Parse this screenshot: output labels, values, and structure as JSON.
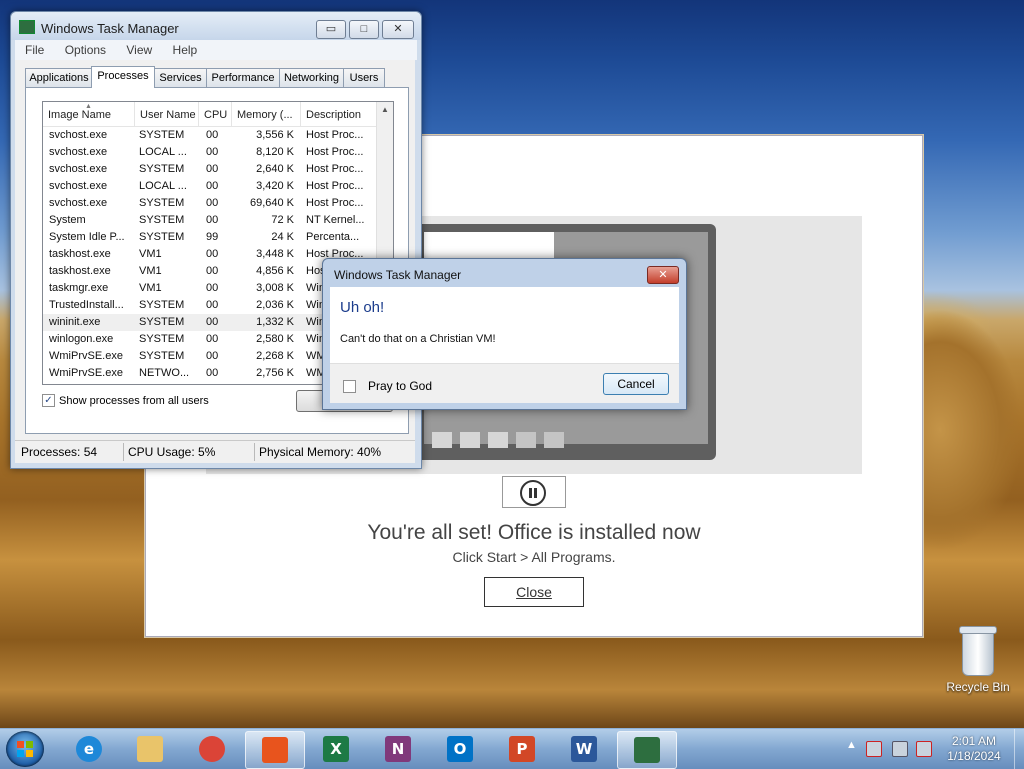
{
  "desktop": {
    "recycle_bin_label": "Recycle Bin"
  },
  "office": {
    "headline": "You're all set! Office is installed now",
    "sub": "Click Start > All Programs.",
    "close_label": "Close"
  },
  "task_manager": {
    "title": "Windows Task Manager",
    "menu": [
      "File",
      "Options",
      "View",
      "Help"
    ],
    "tabs": [
      "Applications",
      "Processes",
      "Services",
      "Performance",
      "Networking",
      "Users"
    ],
    "active_tab": "Processes",
    "columns": [
      "Image Name",
      "User Name",
      "CPU",
      "Memory (...",
      "Description"
    ],
    "rows": [
      {
        "name": "svchost.exe",
        "user": "SYSTEM",
        "cpu": "00",
        "mem": "3,556 K",
        "desc": "Host Proc..."
      },
      {
        "name": "svchost.exe",
        "user": "LOCAL ...",
        "cpu": "00",
        "mem": "8,120 K",
        "desc": "Host Proc..."
      },
      {
        "name": "svchost.exe",
        "user": "SYSTEM",
        "cpu": "00",
        "mem": "2,640 K",
        "desc": "Host Proc..."
      },
      {
        "name": "svchost.exe",
        "user": "LOCAL ...",
        "cpu": "00",
        "mem": "3,420 K",
        "desc": "Host Proc..."
      },
      {
        "name": "svchost.exe",
        "user": "SYSTEM",
        "cpu": "00",
        "mem": "69,640 K",
        "desc": "Host Proc..."
      },
      {
        "name": "System",
        "user": "SYSTEM",
        "cpu": "00",
        "mem": "72 K",
        "desc": "NT Kernel..."
      },
      {
        "name": "System Idle P...",
        "user": "SYSTEM",
        "cpu": "99",
        "mem": "24 K",
        "desc": "Percenta..."
      },
      {
        "name": "taskhost.exe",
        "user": "VM1",
        "cpu": "00",
        "mem": "3,448 K",
        "desc": "Host Proc..."
      },
      {
        "name": "taskhost.exe",
        "user": "VM1",
        "cpu": "00",
        "mem": "4,856 K",
        "desc": "Host"
      },
      {
        "name": "taskmgr.exe",
        "user": "VM1",
        "cpu": "00",
        "mem": "3,008 K",
        "desc": "Win"
      },
      {
        "name": "TrustedInstall...",
        "user": "SYSTEM",
        "cpu": "00",
        "mem": "2,036 K",
        "desc": "Win"
      },
      {
        "name": "wininit.exe",
        "user": "SYSTEM",
        "cpu": "00",
        "mem": "1,332 K",
        "desc": "Win"
      },
      {
        "name": "winlogon.exe",
        "user": "SYSTEM",
        "cpu": "00",
        "mem": "2,580 K",
        "desc": "Win"
      },
      {
        "name": "WmiPrvSE.exe",
        "user": "SYSTEM",
        "cpu": "00",
        "mem": "2,268 K",
        "desc": "WM"
      },
      {
        "name": "WmiPrvSE.exe",
        "user": "NETWO...",
        "cpu": "00",
        "mem": "2,756 K",
        "desc": "WM"
      }
    ],
    "selected_row": 11,
    "show_all_label": "Show processes from all users",
    "status": {
      "processes": "Processes: 54",
      "cpu": "CPU Usage: 5%",
      "memory": "Physical Memory: 40%"
    }
  },
  "dialog": {
    "title": "Windows Task Manager",
    "heading": "Uh oh!",
    "message": "Can't do that on a Christian VM!",
    "checkbox_label": "Pray to God",
    "cancel_label": "Cancel"
  },
  "taskbar": {
    "apps": [
      {
        "id": "ie",
        "label": "e",
        "color": "#1e88d8",
        "active": false
      },
      {
        "id": "explorer",
        "label": "",
        "color": "#e9c46a",
        "active": false
      },
      {
        "id": "chrome",
        "label": "",
        "color": "#db4437",
        "active": false
      },
      {
        "id": "office",
        "label": "",
        "color": "#e8541d",
        "active": true
      },
      {
        "id": "excel",
        "label": "X",
        "color": "#1d7a45",
        "active": false
      },
      {
        "id": "onenote",
        "label": "N",
        "color": "#80397b",
        "active": false
      },
      {
        "id": "outlook",
        "label": "O",
        "color": "#0072c6",
        "active": false
      },
      {
        "id": "powerpoint",
        "label": "P",
        "color": "#d24726",
        "active": false
      },
      {
        "id": "word",
        "label": "W",
        "color": "#2b579a",
        "active": false
      },
      {
        "id": "taskmgr",
        "label": "",
        "color": "#2d6e3f",
        "active": true
      }
    ],
    "time": "2:01 AM",
    "date": "1/18/2024"
  }
}
